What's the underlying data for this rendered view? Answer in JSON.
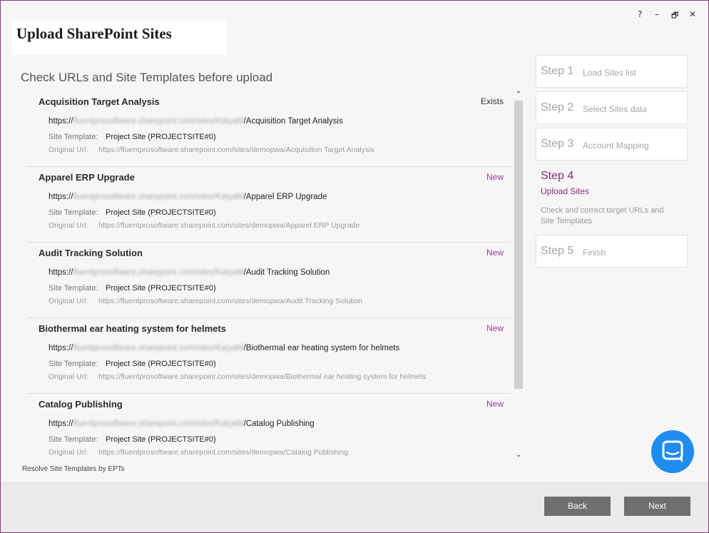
{
  "window": {
    "title": "Upload SharePoint Sites",
    "controls": {
      "help": "?",
      "minimize": "–",
      "restore": "🗗",
      "close": "✕"
    }
  },
  "main": {
    "subtitle": "Check URLs and Site Templates before upload",
    "resolve_text": "Resolve Site Templates by EPTs",
    "site_template_label": "Site Template:",
    "original_url_label": "Original Url:",
    "items": [
      {
        "name": "Acquisition Target Analysis",
        "status": "Exists",
        "url_prefix": "https://",
        "url_hidden": "fluentprosoftware.sharepoint.com/sites/KatyaM",
        "url_suffix": "/Acquisition Target Analysis",
        "template": "Project Site (PROJECTSITE#0)",
        "original_url": "https://fluentprosoftware.sharepoint.com/sites/demopwa/Acquisition Target Analysis"
      },
      {
        "name": "Apparel ERP Upgrade",
        "status": "New",
        "url_prefix": "https://",
        "url_hidden": "fluentprosoftware.sharepoint.com/sites/KatyaM",
        "url_suffix": "/Apparel ERP Upgrade",
        "template": "Project Site (PROJECTSITE#0)",
        "original_url": "https://fluentprosoftware.sharepoint.com/sites/demopwa/Apparel ERP Upgrade"
      },
      {
        "name": "Audit Tracking Solution",
        "status": "New",
        "url_prefix": "https://",
        "url_hidden": "fluentprosoftware.sharepoint.com/sites/KatyaM",
        "url_suffix": "/Audit Tracking Solution",
        "template": "Project Site (PROJECTSITE#0)",
        "original_url": "https://fluentprosoftware.sharepoint.com/sites/demopwa/Audit Tracking Solution"
      },
      {
        "name": "Biothermal ear heating system for helmets",
        "status": "New",
        "url_prefix": "https://",
        "url_hidden": "fluentprosoftware.sharepoint.com/sites/KatyaM",
        "url_suffix": "/Biothermal ear heating system for helmets",
        "template": "Project Site (PROJECTSITE#0)",
        "original_url": "https://fluentprosoftware.sharepoint.com/sites/demopwa/Biothermal ear heating system for helmets"
      },
      {
        "name": "Catalog Publishing",
        "status": "New",
        "url_prefix": "https://",
        "url_hidden": "fluentprosoftware.sharepoint.com/sites/KatyaM",
        "url_suffix": "/Catalog Publishing",
        "template": "Project Site (PROJECTSITE#0)",
        "original_url": "https://fluentprosoftware.sharepoint.com/sites/demopwa/Catalog Publishing"
      }
    ]
  },
  "steps": [
    {
      "number": "Step 1",
      "label": "Load Sites list"
    },
    {
      "number": "Step 2",
      "label": "Select Sites data"
    },
    {
      "number": "Step 3",
      "label": "Account Mapping"
    },
    {
      "number": "Step 4",
      "label": "Upload Sites",
      "description": "Check and correct target URLs and Site Templates",
      "active": true
    },
    {
      "number": "Step 5",
      "label": "Finish"
    }
  ],
  "footer": {
    "back_label": "Back",
    "next_label": "Next"
  },
  "icons": {
    "scroll_up": "⌃",
    "scroll_down": "⌄",
    "chat": "chat-bubble-icon"
  },
  "colors": {
    "accent": "#8b2b77",
    "status_new": "#a43a8e",
    "status_exists": "#333333",
    "button": "#6f6f6f",
    "chat": "#1f8ded"
  }
}
